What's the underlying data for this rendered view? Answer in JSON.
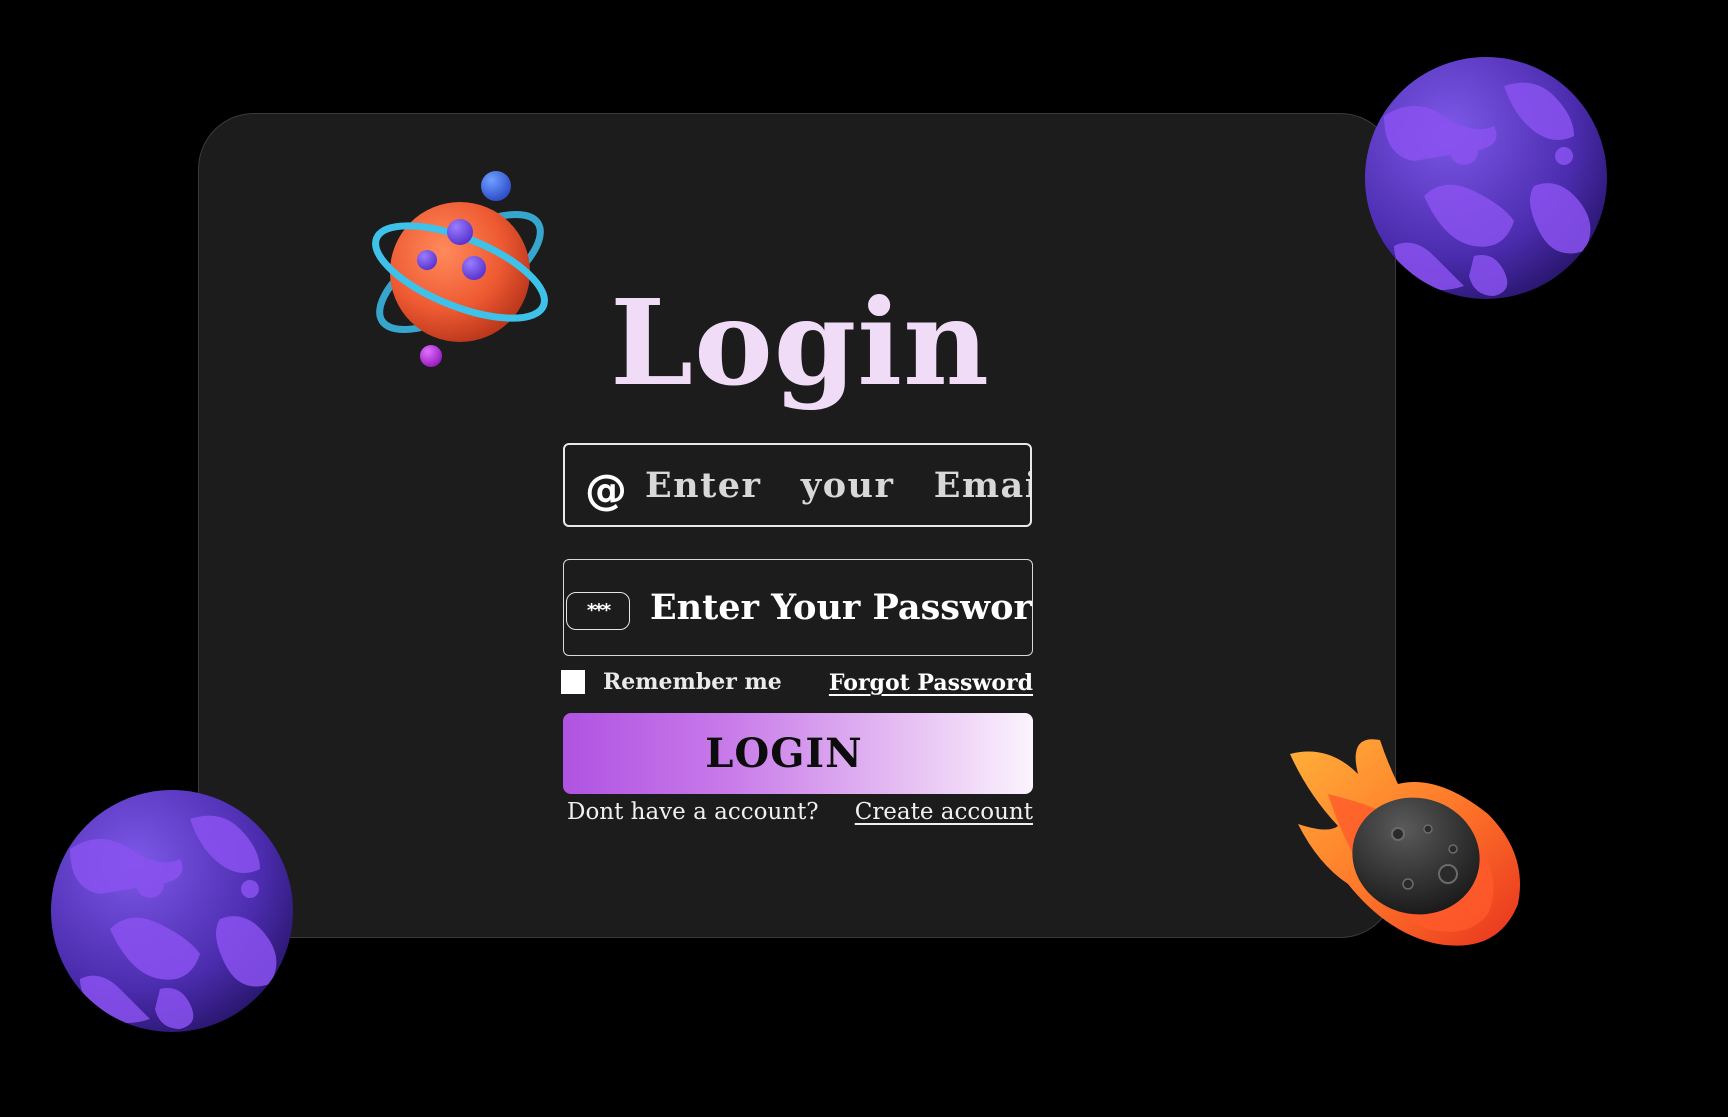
{
  "page": {
    "title": "Login"
  },
  "form": {
    "email_placeholder": "Enter  your  Email....",
    "email_icon": "@",
    "password_placeholder": "Enter Your Password",
    "password_icon": "***",
    "remember_label": "Remember me",
    "remember_checked": false,
    "forgot_label": "Forgot Password",
    "login_label": "LOGIN",
    "no_account_text": "Dont have a account?",
    "create_account_label": "Create account"
  },
  "colors": {
    "background": "#000000",
    "card": "#1c1c1c",
    "title": "#f1dcf8",
    "button_gradient_start": "#b053e2",
    "button_gradient_end": "#fcf4fe",
    "planet_purple": "#6b3fd6",
    "planet_orange": "#ee5a32",
    "comet_flame": "#ff6a2a"
  },
  "icons": {
    "email": "at-icon",
    "password": "password-dots-icon",
    "decor_top_left": "atom-planet-icon",
    "decor_top_right": "purple-planet-icon",
    "decor_bottom_left": "purple-planet-icon",
    "decor_bottom_right": "comet-meteor-icon"
  }
}
